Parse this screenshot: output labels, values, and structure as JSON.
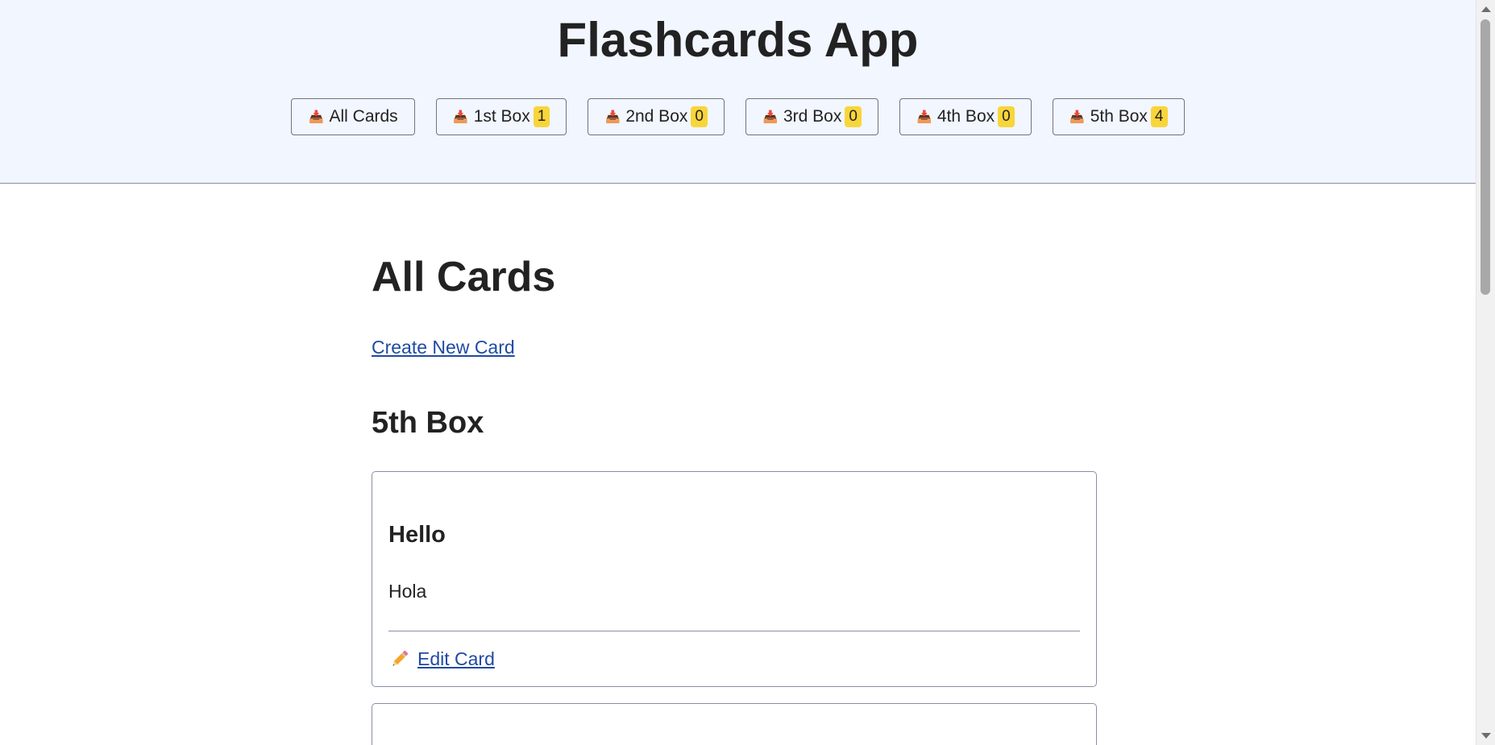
{
  "header": {
    "title": "Flashcards App",
    "nav": [
      {
        "icon": "inbox-tray-icon",
        "glyph": "📥",
        "label": "All Cards",
        "count": null
      },
      {
        "icon": "box-tray-icon",
        "glyph": "📥",
        "label": "1st Box",
        "count": "1"
      },
      {
        "icon": "box-tray-icon",
        "glyph": "📥",
        "label": "2nd Box",
        "count": "0"
      },
      {
        "icon": "box-tray-icon",
        "glyph": "📥",
        "label": "3rd Box",
        "count": "0"
      },
      {
        "icon": "box-tray-icon",
        "glyph": "📥",
        "label": "4th Box",
        "count": "0"
      },
      {
        "icon": "box-tray-icon",
        "glyph": "📥",
        "label": "5th Box",
        "count": "4"
      }
    ]
  },
  "main": {
    "title": "All Cards",
    "create_link": "Create New Card",
    "section_title": "5th Box",
    "cards": [
      {
        "front": "Hello",
        "back": "Hola",
        "edit_label": "Edit Card",
        "edit_icon": "pencil-icon"
      }
    ]
  },
  "colors": {
    "header_bg": "#f2f6fe",
    "badge_bg": "#f8d53a",
    "link": "#1f4aa3",
    "border": "#8a8ea6"
  }
}
